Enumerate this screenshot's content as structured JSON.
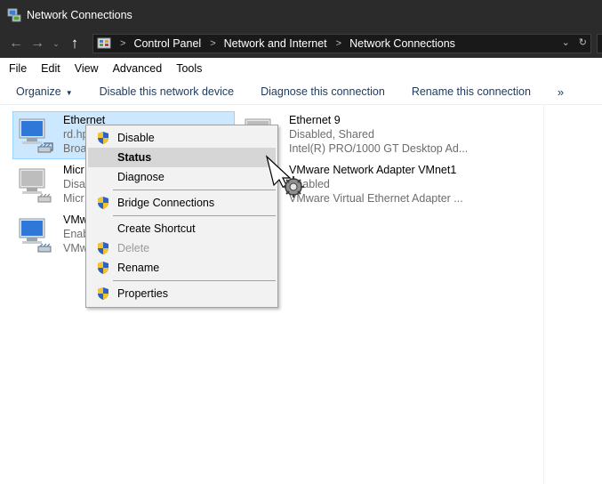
{
  "window": {
    "title": "Network Connections"
  },
  "address": {
    "crumbs": [
      "Control Panel",
      "Network and Internet",
      "Network Connections"
    ],
    "separator": ">",
    "dropdown_glyph": "⌄",
    "refresh_glyph": "↻"
  },
  "nav": {
    "back_glyph": "←",
    "forward_glyph": "→",
    "recent_glyph": "⌄",
    "up_glyph": "↑"
  },
  "menubar": {
    "items": [
      "File",
      "Edit",
      "View",
      "Advanced",
      "Tools"
    ]
  },
  "commandbar": {
    "organize": "Organize",
    "organize_arrow": "▼",
    "items": [
      "Disable this network device",
      "Diagnose this connection",
      "Rename this connection"
    ],
    "more": "»"
  },
  "connections": [
    {
      "name": "Ethernet",
      "status": "rd.hp",
      "device": "Broa",
      "selected": true
    },
    {
      "name": "Micr",
      "status": "Disab",
      "device": "Micr",
      "selected": false
    },
    {
      "name": "VMw",
      "status": "Enab",
      "device": "VMw",
      "selected": false
    },
    {
      "name": "Ethernet 9",
      "status": "Disabled, Shared",
      "device": "Intel(R) PRO/1000 GT Desktop Ad...",
      "selected": false
    },
    {
      "name": "VMware Network Adapter VMnet1",
      "status": "Enabled",
      "device": "VMware Virtual Ethernet Adapter ...",
      "selected": false
    }
  ],
  "context_menu": {
    "items": [
      {
        "label": "Disable",
        "shield": true
      },
      {
        "label": "Status",
        "shield": false,
        "bold": true,
        "hover": true
      },
      {
        "label": "Diagnose",
        "shield": false
      },
      {
        "label": "Bridge Connections",
        "shield": true
      },
      {
        "label": "Create Shortcut",
        "shield": false
      },
      {
        "label": "Delete",
        "shield": true,
        "disabled": true
      },
      {
        "label": "Rename",
        "shield": true
      },
      {
        "label": "Properties",
        "shield": true
      }
    ]
  },
  "colors": {
    "titlebar_bg": "#2b2b2b",
    "selection_bg": "#cce8ff",
    "selection_border": "#99d1ff",
    "command_text": "#1e395b",
    "menu_bg": "#f2f2f2",
    "menu_hover": "#d6d6d6"
  }
}
